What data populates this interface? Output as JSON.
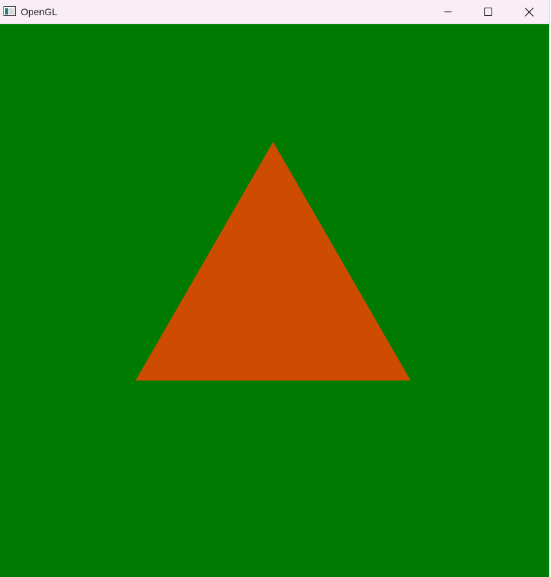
{
  "window": {
    "title": "OpenGL",
    "icon": "opengl-window-icon",
    "controls": {
      "minimize_icon": "minimize-icon",
      "maximize_icon": "maximize-icon",
      "close_icon": "close-icon"
    }
  },
  "scene": {
    "clear_color": "#007a00",
    "triangle_color": "#cd4c02",
    "shape": "triangle"
  },
  "colors": {
    "titlebar_bg": "#f9eef5",
    "icon_stroke": "#1a1a1a"
  }
}
